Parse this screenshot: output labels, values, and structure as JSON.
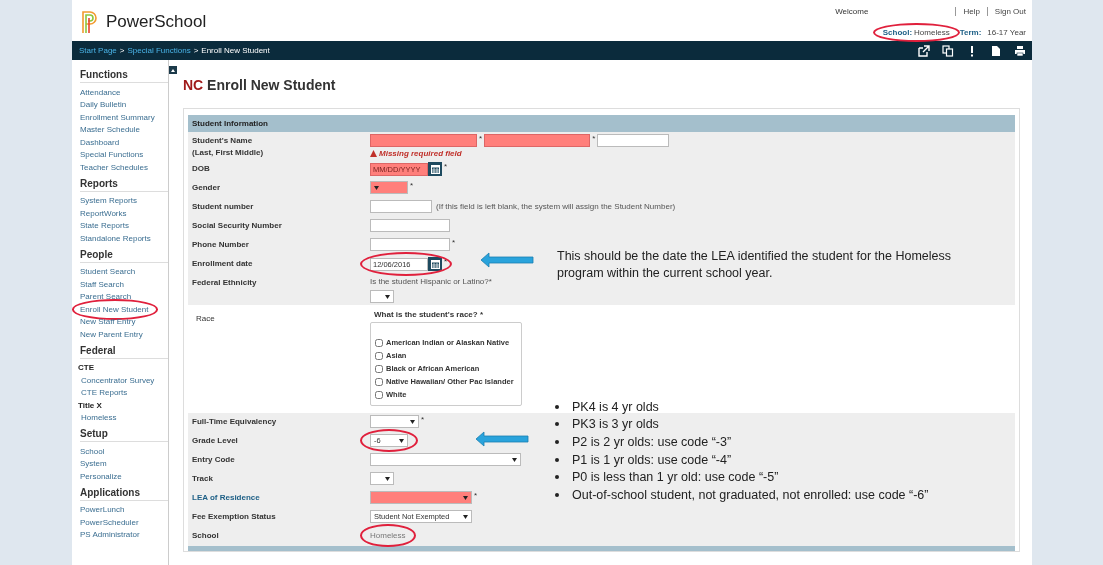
{
  "header": {
    "logo_text": "PowerSchool",
    "welcome": "Welcome",
    "links": [
      "Help",
      "Sign Out"
    ],
    "school_label": "School:",
    "school_value": "Homeless",
    "school_highlighted": true,
    "term_label": "Term:",
    "term_value": "16-17 Year"
  },
  "breadcrumb": {
    "separator": ">",
    "items": [
      {
        "label": "Start Page",
        "link": true
      },
      {
        "label": "Special Functions",
        "link": true
      },
      {
        "label": "Enroll New Student",
        "link": false
      }
    ]
  },
  "sidebar": [
    {
      "title": "Functions",
      "items": [
        {
          "label": "Attendance",
          "kind": "link",
          "highlighted": false
        },
        {
          "label": "Daily Bulletin",
          "kind": "link",
          "highlighted": false
        },
        {
          "label": "Enrollment Summary",
          "kind": "link",
          "highlighted": false
        },
        {
          "label": "Master Schedule",
          "kind": "link",
          "highlighted": false
        },
        {
          "label": "Dashboard",
          "kind": "link",
          "highlighted": false
        },
        {
          "label": "Special Functions",
          "kind": "link",
          "highlighted": false
        },
        {
          "label": "Teacher Schedules",
          "kind": "link",
          "highlighted": false
        }
      ]
    },
    {
      "title": "Reports",
      "items": [
        {
          "label": "System Reports",
          "kind": "link",
          "highlighted": false
        },
        {
          "label": "ReportWorks",
          "kind": "link",
          "highlighted": false
        },
        {
          "label": "State Reports",
          "kind": "link",
          "highlighted": false
        },
        {
          "label": "Standalone Reports",
          "kind": "link",
          "highlighted": false
        }
      ]
    },
    {
      "title": "People",
      "items": [
        {
          "label": "Student Search",
          "kind": "link",
          "highlighted": false
        },
        {
          "label": "Staff Search",
          "kind": "link",
          "highlighted": false
        },
        {
          "label": "Parent Search",
          "kind": "link",
          "highlighted": false
        },
        {
          "label": "Enroll New Student",
          "kind": "link",
          "highlighted": true
        },
        {
          "label": "New Staff Entry",
          "kind": "link",
          "highlighted": false
        },
        {
          "label": "New Parent Entry",
          "kind": "link",
          "highlighted": false
        }
      ]
    },
    {
      "title": "Federal",
      "items": [
        {
          "label": "CTE",
          "kind": "heading",
          "highlighted": false
        },
        {
          "label": "Concentrator Survey",
          "kind": "sublink",
          "highlighted": false
        },
        {
          "label": "CTE Reports",
          "kind": "sublink",
          "highlighted": false
        },
        {
          "label": "Title X",
          "kind": "heading",
          "highlighted": false
        },
        {
          "label": "Homeless",
          "kind": "sublink",
          "highlighted": false
        }
      ]
    },
    {
      "title": "Setup",
      "items": [
        {
          "label": "School",
          "kind": "link",
          "highlighted": false
        },
        {
          "label": "System",
          "kind": "link",
          "highlighted": false
        },
        {
          "label": "Personalize",
          "kind": "link",
          "highlighted": false
        }
      ]
    },
    {
      "title": "Applications",
      "items": [
        {
          "label": "PowerLunch",
          "kind": "link",
          "highlighted": false
        },
        {
          "label": "PowerScheduler",
          "kind": "link",
          "highlighted": false
        },
        {
          "label": "PS Administrator",
          "kind": "link",
          "highlighted": false
        }
      ]
    }
  ],
  "page_title": {
    "prefix": "NC",
    "text": "Enroll New Student"
  },
  "form": {
    "section": "Student Information",
    "rows": [
      {
        "kind": "name",
        "label": "Student's Name",
        "sublabel": "(Last, First Middle)",
        "fields": [
          {
            "invalid": true,
            "marker": "*"
          },
          {
            "invalid": true,
            "marker": "*"
          },
          {
            "invalid": false
          }
        ],
        "error": "Missing required field"
      },
      {
        "kind": "date",
        "label": "DOB",
        "placeholder": "MM/DD/YYYY",
        "invalid": true,
        "marker": "*",
        "highlighted": false
      },
      {
        "kind": "select",
        "label": "Gender",
        "invalid": true,
        "marker": "*",
        "highlighted": false
      },
      {
        "kind": "text",
        "label": "Student number",
        "note": "(If this field is left blank, the system will assign the Student Number)"
      },
      {
        "kind": "text",
        "label": "Social Security Number"
      },
      {
        "kind": "text",
        "label": "Phone Number",
        "marker": "*"
      },
      {
        "kind": "date",
        "label": "Enrollment date",
        "value": "12/06/2016",
        "invalid": false,
        "marker": "*",
        "highlighted": true
      },
      {
        "kind": "question",
        "label": "Federal Ethnicity",
        "question": "Is the student Hispanic or Latino?*"
      },
      {
        "kind": "checklist",
        "label": "Race",
        "question": "What is the student's race? *",
        "options": [
          {
            "label": "American Indian or Alaskan Native",
            "checked": false
          },
          {
            "label": "Asian",
            "checked": false
          },
          {
            "label": "Black or African American",
            "checked": false
          },
          {
            "label": "Native Hawaiian/ Other Pac Islander",
            "checked": false
          },
          {
            "label": "White",
            "checked": false
          }
        ]
      },
      {
        "kind": "select",
        "label": "Full-Time Equivalency",
        "invalid": false,
        "marker": "*",
        "highlighted": false
      },
      {
        "kind": "select",
        "label": "Grade Level",
        "value": "-6",
        "invalid": false,
        "highlighted": true
      },
      {
        "kind": "select",
        "label": "Entry Code",
        "invalid": false,
        "highlighted": false
      },
      {
        "kind": "select",
        "label": "Track",
        "invalid": false,
        "highlighted": false
      },
      {
        "kind": "select",
        "label": "LEA of Residence",
        "label_link": true,
        "invalid": true,
        "marker": "*",
        "highlighted": false
      },
      {
        "kind": "select",
        "label": "Fee Exemption Status",
        "value": "Student Not Exempted",
        "invalid": false,
        "highlighted": false
      },
      {
        "kind": "static",
        "label": "School",
        "value": "Homeless",
        "highlighted": true
      }
    ]
  },
  "annotations": [
    {
      "kind": "callout",
      "text": "This should be the date the LEA identified the student for the Homeless program within the current school year."
    },
    {
      "kind": "bullets",
      "items": [
        "PK4 is 4 yr olds",
        "PK3 is 3 yr olds",
        "P2 is 2 yr olds: use code  “-3”",
        "P1 is 1 yr olds: use code “-4”",
        "P0 is less than 1 yr old: use code “-5”",
        "Out-of-school student, not graduated, not enrolled: use code “-6”"
      ]
    }
  ]
}
